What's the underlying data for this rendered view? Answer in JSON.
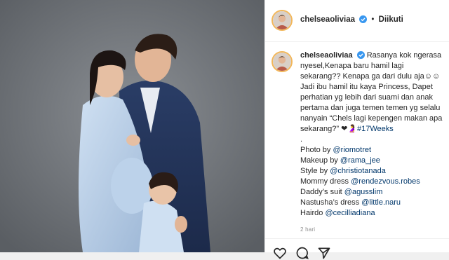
{
  "post": {
    "username": "chelseaoliviaa",
    "status": "Diikuti",
    "caption_main": "Rasanya kok ngerasa nyesel,Kenapa baru hamil lagi sekarang?? Kenapa ga dari dulu aja☺☺ Jadi ibu hamil itu kaya Princess, Dapet perhatian yg lebih dari suami dan anak pertama dan juga temen temen yg selalu nanyain “Chels lagi kepengen makan apa sekarang?” ❤🤰",
    "hashtag": "#17Weeks",
    "separator": ".",
    "credits": [
      {
        "label": "Photo by ",
        "handle": "@riomotret"
      },
      {
        "label": "Makeup by ",
        "handle": "@rama_jee"
      },
      {
        "label": "Style by ",
        "handle": "@christiotanada"
      },
      {
        "label": "Mommy dress ",
        "handle": "@rendezvous.robes"
      },
      {
        "label": "Daddy’s suit ",
        "handle": "@agusslim"
      },
      {
        "label": "Nastusha’s dress ",
        "handle": "@little.naru"
      },
      {
        "label": "Hairdo ",
        "handle": "@cecilliadiana"
      }
    ],
    "time": "2 hari"
  },
  "icons": {
    "verified": "verified-badge-icon",
    "like": "heart-icon",
    "comment": "comment-icon",
    "share": "paper-plane-icon"
  },
  "colors": {
    "link": "#00376b",
    "verified": "#3897f0",
    "ring": "#f2b75a"
  }
}
